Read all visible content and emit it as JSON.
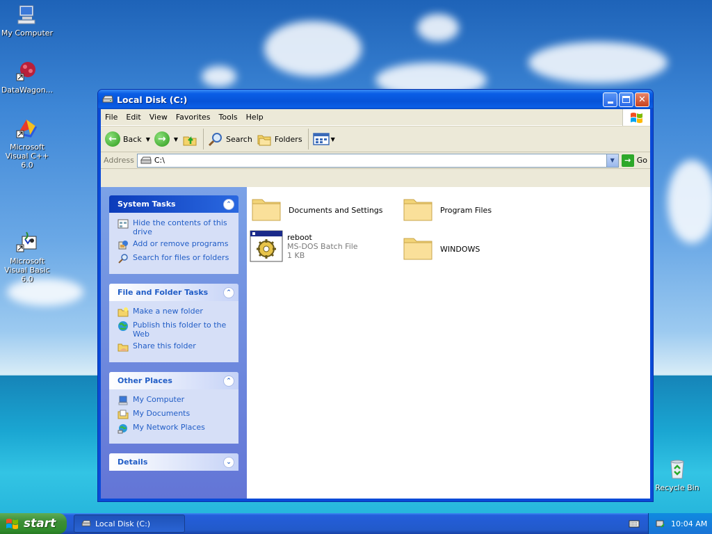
{
  "desktop": {
    "icons": [
      {
        "label": "My Computer"
      },
      {
        "label": "DataWagon..."
      },
      {
        "label": "Microsoft Visual C++ 6.0"
      },
      {
        "label": "Microsoft Visual Basic 6.0"
      },
      {
        "label": "Recycle Bin"
      }
    ]
  },
  "window": {
    "title": "Local Disk (C:)",
    "menu": [
      "File",
      "Edit",
      "View",
      "Favorites",
      "Tools",
      "Help"
    ],
    "toolbar": {
      "back_label": "Back",
      "search_label": "Search",
      "folders_label": "Folders"
    },
    "address": {
      "label": "Address",
      "value": "C:\\",
      "go_label": "Go"
    },
    "task_panes": {
      "system_tasks": {
        "title": "System Tasks",
        "items": [
          "Hide the contents of this drive",
          "Add or remove programs",
          "Search for files or folders"
        ]
      },
      "file_folder_tasks": {
        "title": "File and Folder Tasks",
        "items": [
          "Make a new folder",
          "Publish this folder to the Web",
          "Share this folder"
        ]
      },
      "other_places": {
        "title": "Other Places",
        "items": [
          "My Computer",
          "My Documents",
          "My Network Places"
        ]
      },
      "details": {
        "title": "Details"
      }
    },
    "files": [
      {
        "name": "Documents and Settings",
        "type": "folder"
      },
      {
        "name": "Program Files",
        "type": "folder"
      },
      {
        "name": "reboot",
        "type": "batch",
        "desc": "MS-DOS Batch File",
        "size": "1 KB"
      },
      {
        "name": "WINDOWS",
        "type": "folder"
      }
    ]
  },
  "taskbar": {
    "start_label": "start",
    "task_button_label": "Local Disk (C:)",
    "clock": "10:04 AM"
  }
}
